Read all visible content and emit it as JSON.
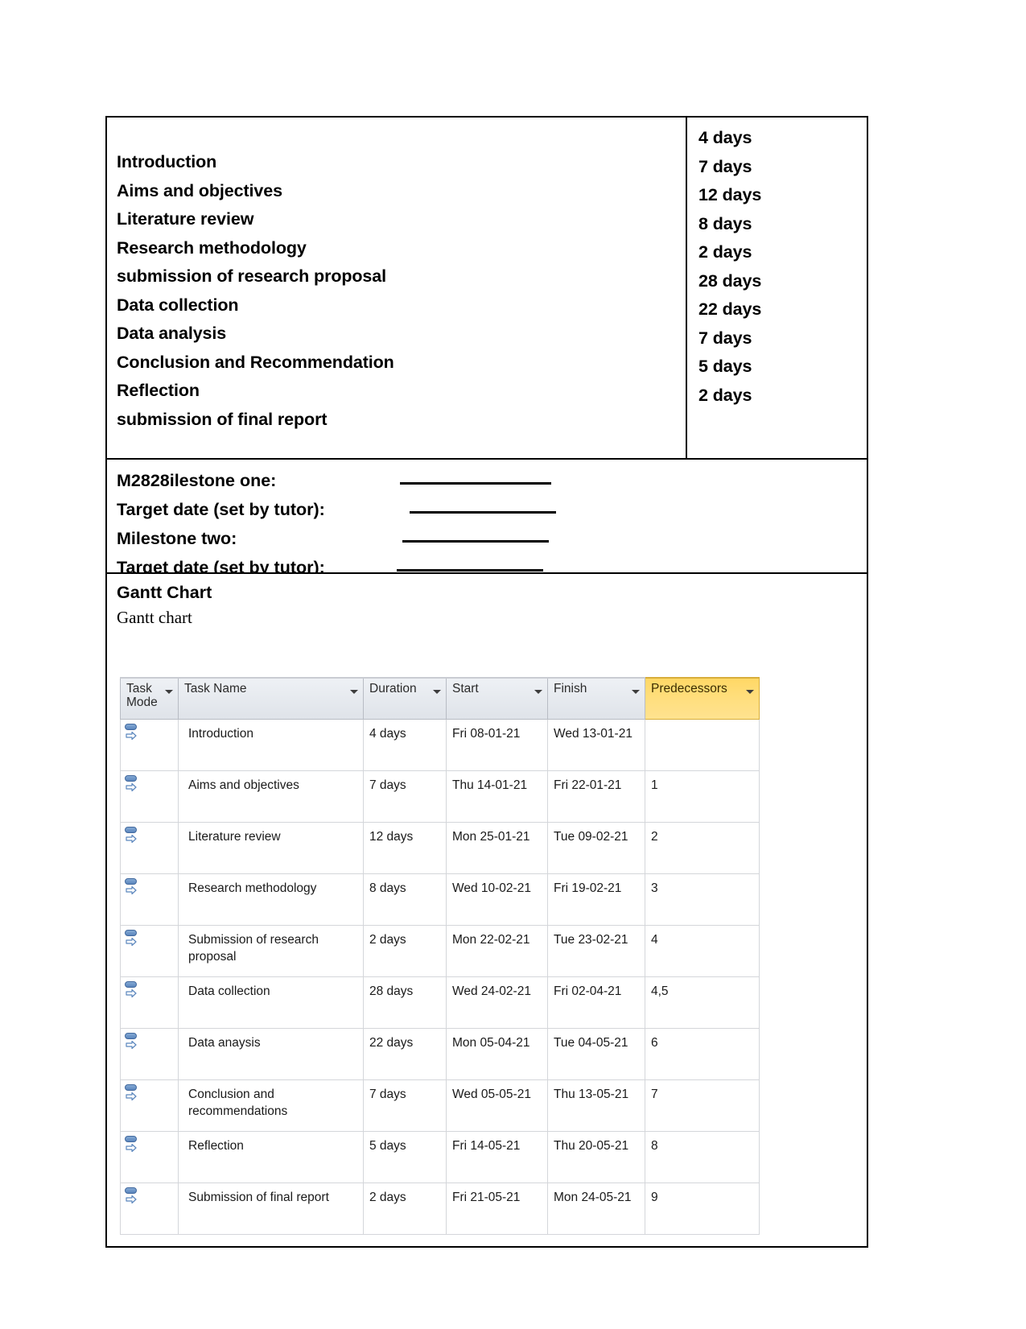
{
  "document": {
    "schedule_table": {
      "tasks": [
        "Introduction",
        "Aims and objectives",
        "Literature review",
        "Research methodology",
        "submission of research proposal",
        "Data collection",
        "Data analysis",
        "Conclusion and Recommendation",
        "Reflection",
        "submission of final report"
      ],
      "durations": [
        "4 days",
        "7 days",
        "12 days",
        "8 days",
        "2 days",
        "28 days",
        "22 days",
        "7 days",
        "5 days",
        "2 days"
      ]
    },
    "milestones": [
      {
        "label": "M2828ilestone one:"
      },
      {
        "label": "Target date (set by tutor):"
      },
      {
        "label": "Milestone two:"
      },
      {
        "label": "Target date (set by tutor):"
      }
    ],
    "gantt": {
      "heading": "Gantt Chart",
      "caption": "Gantt chart"
    }
  },
  "chart_data": {
    "type": "table",
    "title": "Gantt Chart",
    "columns": [
      "Task Mode",
      "Task Name",
      "Duration",
      "Start",
      "Finish",
      "Predecessors"
    ],
    "highlight_column": "Predecessors",
    "highlight_color": "#ffd866",
    "rows": [
      {
        "task_mode": "manually-scheduled",
        "name": "Introduction",
        "duration": "4 days",
        "start": "Fri 08-01-21",
        "finish": "Wed 13-01-21",
        "predecessors": ""
      },
      {
        "task_mode": "manually-scheduled",
        "name": "Aims and objectives",
        "duration": "7 days",
        "start": "Thu 14-01-21",
        "finish": "Fri 22-01-21",
        "predecessors": "1"
      },
      {
        "task_mode": "manually-scheduled",
        "name": "Literature review",
        "duration": "12 days",
        "start": "Mon 25-01-21",
        "finish": "Tue 09-02-21",
        "predecessors": "2"
      },
      {
        "task_mode": "manually-scheduled",
        "name": "Research methodology",
        "duration": "8 days",
        "start": "Wed 10-02-21",
        "finish": "Fri 19-02-21",
        "predecessors": "3"
      },
      {
        "task_mode": "manually-scheduled",
        "name": "Submission of research proposal",
        "duration": "2 days",
        "start": "Mon 22-02-21",
        "finish": "Tue 23-02-21",
        "predecessors": "4"
      },
      {
        "task_mode": "manually-scheduled",
        "name": "Data collection",
        "duration": "28 days",
        "start": "Wed 24-02-21",
        "finish": "Fri 02-04-21",
        "predecessors": "4,5"
      },
      {
        "task_mode": "manually-scheduled",
        "name": "Data anaysis",
        "duration": "22 days",
        "start": "Mon 05-04-21",
        "finish": "Tue 04-05-21",
        "predecessors": "6"
      },
      {
        "task_mode": "manually-scheduled",
        "name": "Conclusion and recommendations",
        "duration": "7 days",
        "start": "Wed 05-05-21",
        "finish": "Thu 13-05-21",
        "predecessors": "7"
      },
      {
        "task_mode": "manually-scheduled",
        "name": "Reflection",
        "duration": "5 days",
        "start": "Fri 14-05-21",
        "finish": "Thu 20-05-21",
        "predecessors": "8"
      },
      {
        "task_mode": "manually-scheduled",
        "name": "Submission of final report",
        "duration": "2 days",
        "start": "Fri 21-05-21",
        "finish": "Mon 24-05-21",
        "predecessors": "9"
      }
    ]
  }
}
